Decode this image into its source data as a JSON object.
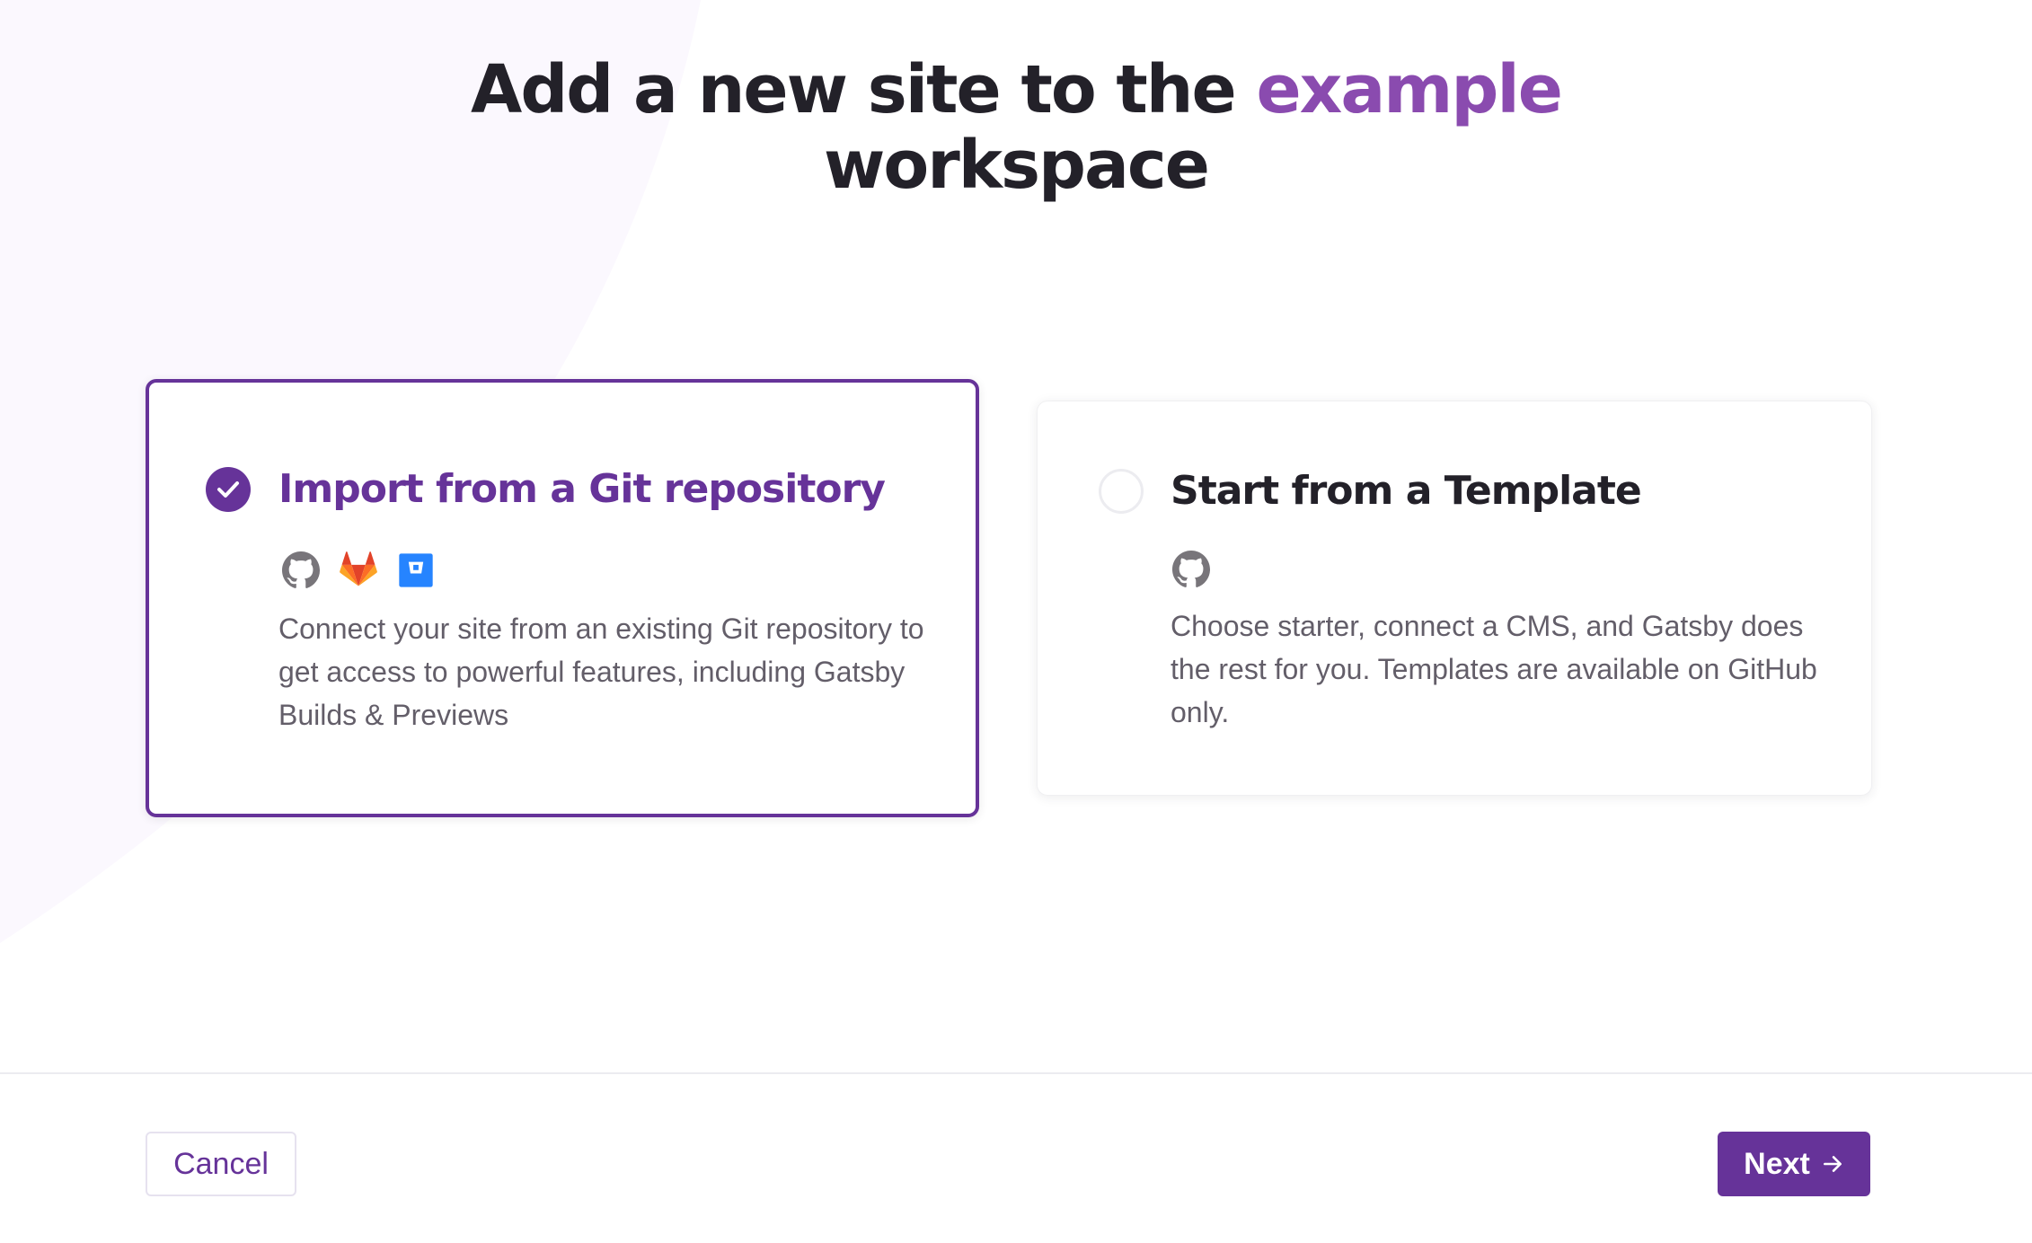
{
  "header": {
    "title_prefix": "Add a new site to the ",
    "title_accent": "example",
    "title_suffix": "workspace"
  },
  "options": [
    {
      "title": "Import from a Git repository",
      "selected": true,
      "icons": [
        "github-icon",
        "gitlab-icon",
        "bitbucket-icon"
      ],
      "description": "Connect your site from an existing Git repository to get access to powerful features, including Gatsby Builds & Previews"
    },
    {
      "title": "Start from a Template",
      "selected": false,
      "icons": [
        "github-icon"
      ],
      "description": "Choose starter, connect a CMS, and Gatsby does the rest for you. Templates are available on GitHub only."
    }
  ],
  "footer": {
    "cancel_label": "Cancel",
    "next_label": "Next",
    "next_icon": "arrow-right-icon"
  },
  "colors": {
    "accent": "#8a4baf",
    "primary": "#663399",
    "heading": "#232129",
    "body_text": "#635e69",
    "gitlab": "#e24329",
    "bitbucket": "#2684ff"
  }
}
